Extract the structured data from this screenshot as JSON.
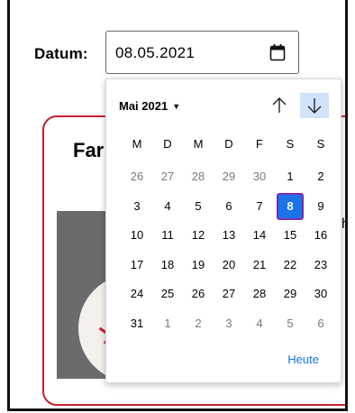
{
  "form": {
    "label": "Datum:",
    "date_value": "08.05.2021"
  },
  "card": {
    "title_visible": "Far",
    "side_text_visible": "he"
  },
  "calendar": {
    "month_label": "Mai 2021",
    "weekdays": [
      "M",
      "D",
      "M",
      "D",
      "F",
      "S",
      "S"
    ],
    "days": [
      {
        "d": "26",
        "muted": true
      },
      {
        "d": "27",
        "muted": true
      },
      {
        "d": "28",
        "muted": true
      },
      {
        "d": "29",
        "muted": true
      },
      {
        "d": "30",
        "muted": true
      },
      {
        "d": "1",
        "muted": false
      },
      {
        "d": "2",
        "muted": false
      },
      {
        "d": "3",
        "muted": false
      },
      {
        "d": "4",
        "muted": false
      },
      {
        "d": "5",
        "muted": false
      },
      {
        "d": "6",
        "muted": false
      },
      {
        "d": "7",
        "muted": false
      },
      {
        "d": "8",
        "muted": false,
        "selected": true
      },
      {
        "d": "9",
        "muted": false
      },
      {
        "d": "10",
        "muted": false
      },
      {
        "d": "11",
        "muted": false
      },
      {
        "d": "12",
        "muted": false
      },
      {
        "d": "13",
        "muted": false
      },
      {
        "d": "14",
        "muted": false
      },
      {
        "d": "15",
        "muted": false
      },
      {
        "d": "16",
        "muted": false
      },
      {
        "d": "17",
        "muted": false
      },
      {
        "d": "18",
        "muted": false
      },
      {
        "d": "19",
        "muted": false
      },
      {
        "d": "20",
        "muted": false
      },
      {
        "d": "21",
        "muted": false
      },
      {
        "d": "22",
        "muted": false
      },
      {
        "d": "23",
        "muted": false
      },
      {
        "d": "24",
        "muted": false
      },
      {
        "d": "25",
        "muted": false
      },
      {
        "d": "26",
        "muted": false
      },
      {
        "d": "27",
        "muted": false
      },
      {
        "d": "28",
        "muted": false
      },
      {
        "d": "29",
        "muted": false
      },
      {
        "d": "30",
        "muted": false
      },
      {
        "d": "31",
        "muted": false
      },
      {
        "d": "1",
        "muted": true
      },
      {
        "d": "2",
        "muted": true
      },
      {
        "d": "3",
        "muted": true
      },
      {
        "d": "4",
        "muted": true
      },
      {
        "d": "5",
        "muted": true
      },
      {
        "d": "6",
        "muted": true
      }
    ],
    "today_label": "Heute",
    "icons": {
      "calendar": "calendar-icon",
      "prev": "arrow-up-icon",
      "next": "arrow-down-icon",
      "caret": "caret-down-icon"
    }
  },
  "colors": {
    "accent": "#1a73e8",
    "selected_outline": "#7a2ab3",
    "card_border": "#c8202c",
    "nav_highlight": "#cfe3fb"
  }
}
